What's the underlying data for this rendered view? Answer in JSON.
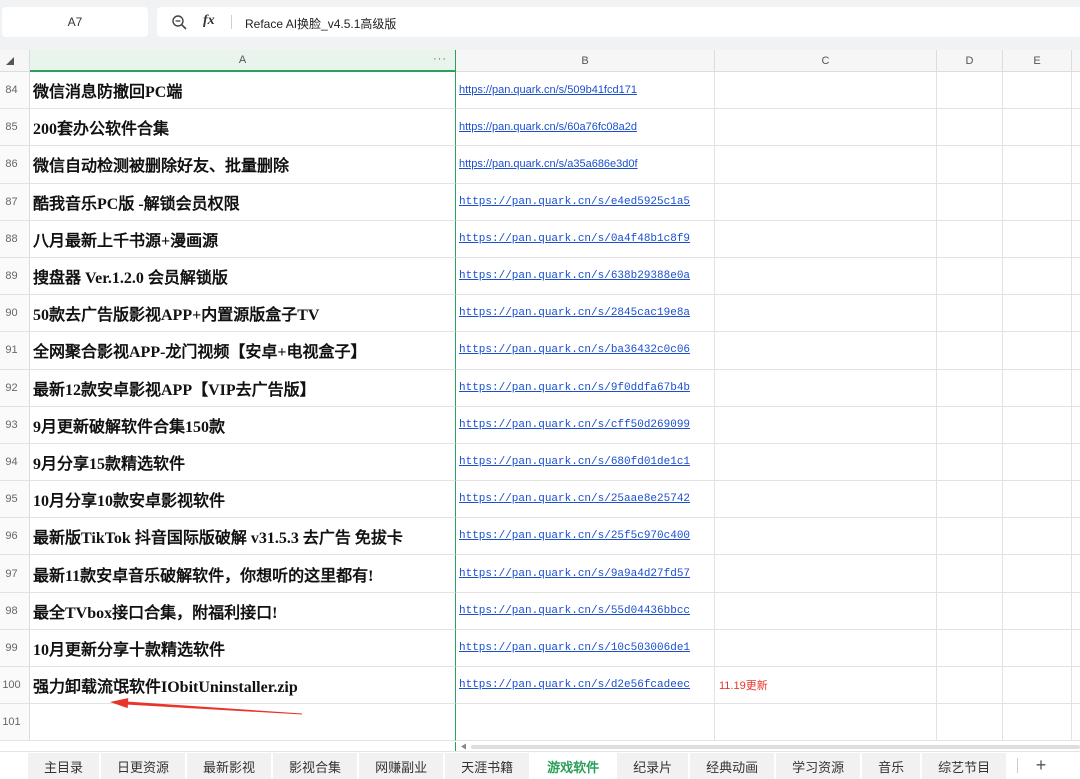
{
  "formula_bar": {
    "cell_ref": "A7",
    "fx_label": "fx",
    "content": "Reface AI换脸_v4.5.1高级版"
  },
  "column_headers": [
    "A",
    "B",
    "C",
    "D",
    "E"
  ],
  "column_more": "···",
  "rows": [
    {
      "num": "84",
      "title": "微信消息防撤回PC端",
      "link": "https://pan.quark.cn/s/509b41fcd171"
    },
    {
      "num": "85",
      "title": "200套办公软件合集",
      "link": "https://pan.quark.cn/s/60a76fc08a2d"
    },
    {
      "num": "86",
      "title": "微信自动检测被删除好友、批量删除",
      "link": "https://pan.quark.cn/s/a35a686e3d0f"
    },
    {
      "num": "87",
      "title": "酷我音乐PC版 -解锁会员权限",
      "link": "https://pan.quark.cn/s/e4ed5925c1a5"
    },
    {
      "num": "88",
      "title": "八月最新上千书源+漫画源",
      "link": "https://pan.quark.cn/s/0a4f48b1c8f9"
    },
    {
      "num": "89",
      "title": "搜盘器 Ver.1.2.0 会员解锁版",
      "link": "https://pan.quark.cn/s/638b29388e0a"
    },
    {
      "num": "90",
      "title": "50款去广告版影视APP+内置源版盒子TV",
      "link": "https://pan.quark.cn/s/2845cac19e8a"
    },
    {
      "num": "91",
      "title": "全网聚合影视APP-龙门视频【安卓+电视盒子】",
      "link": "https://pan.quark.cn/s/ba36432c0c06"
    },
    {
      "num": "92",
      "title": "最新12款安卓影视APP【VIP去广告版】",
      "link": "https://pan.quark.cn/s/9f0ddfa67b4b"
    },
    {
      "num": "93",
      "title": "9月更新破解软件合集150款",
      "link": "https://pan.quark.cn/s/cff50d269099"
    },
    {
      "num": "94",
      "title": "9月分享15款精选软件",
      "link": "https://pan.quark.cn/s/680fd01de1c1"
    },
    {
      "num": "95",
      "title": "10月分享10款安卓影视软件",
      "link": "https://pan.quark.cn/s/25aae8e25742"
    },
    {
      "num": "96",
      "title": "最新版TikTok 抖音国际版破解 v31.5.3 去广告 免拔卡",
      "link": "https://pan.quark.cn/s/25f5c970c400"
    },
    {
      "num": "97",
      "title": "最新11款安卓音乐破解软件，你想听的这里都有!",
      "link": "https://pan.quark.cn/s/9a9a4d27fd57"
    },
    {
      "num": "98",
      "title": "最全TVbox接口合集，附福利接口!",
      "link": "https://pan.quark.cn/s/55d04436bbcc"
    },
    {
      "num": "99",
      "title": "10月更新分享十款精选软件",
      "link": "https://pan.quark.cn/s/10c503006de1"
    },
    {
      "num": "100",
      "title": "强力卸载流氓软件IObitUninstaller.zip",
      "link": "https://pan.quark.cn/s/d2e56fcadeec",
      "note": "11.19更新"
    },
    {
      "num": "101"
    }
  ],
  "sheet_tabs": [
    "主目录",
    "日更资源",
    "最新影视",
    "影视合集",
    "网赚副业",
    "天涯书籍",
    "游戏软件",
    "纪录片",
    "经典动画",
    "学习资源",
    "音乐",
    "综艺节目"
  ],
  "active_tab": "游戏软件",
  "add_tab_label": "+",
  "icons": {
    "select_all": "select-all-icon",
    "zoom": "zoom-icon",
    "scroll_left": "scroll-left-icon",
    "annotation": "red-arrow-annotation"
  },
  "colors": {
    "accent_green": "#2aa05a",
    "link_blue": "#1a4fd0",
    "note_red": "#e8352b",
    "annotation_red": "#e8352b"
  }
}
